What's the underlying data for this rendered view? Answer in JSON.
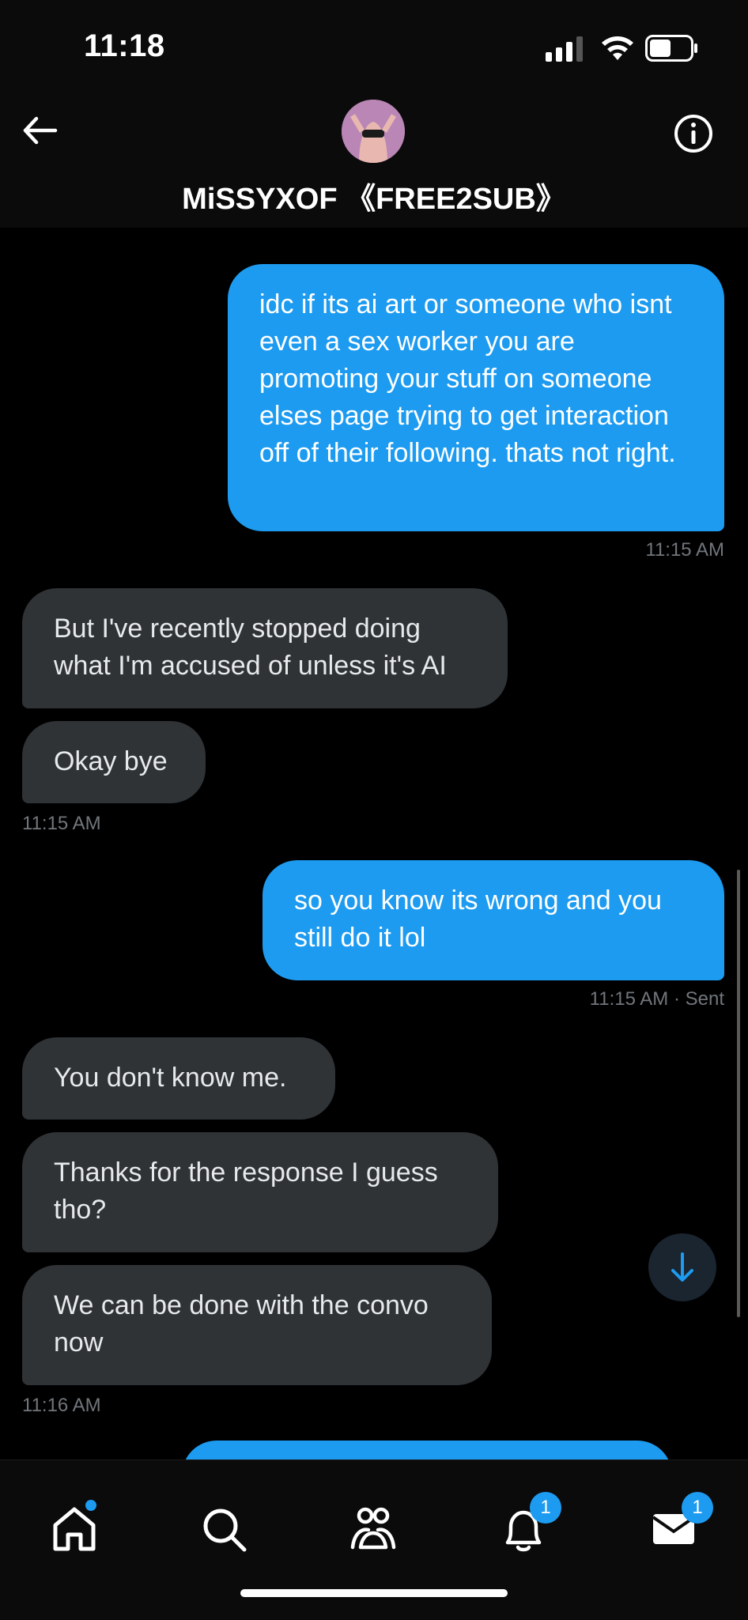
{
  "status_bar": {
    "time": "11:18"
  },
  "header": {
    "contact_name": "MiSSYXOF 《FREE2SUB》"
  },
  "messages": [
    {
      "text": "idc if its ai art or someone who isnt even a sex worker you are promoting your stuff on someone elses page trying to get interaction off of their following. thats not right.",
      "direction": "outgoing",
      "timestamp": "11:15 AM"
    },
    {
      "text": "But I've recently stopped doing what I'm accused of unless it's AI",
      "direction": "incoming"
    },
    {
      "text": "Okay bye",
      "direction": "incoming",
      "timestamp": "11:15 AM"
    },
    {
      "text": "so you know its wrong and you still do it lol",
      "direction": "outgoing",
      "timestamp": "11:15 AM · Sent"
    },
    {
      "text": "You don't know me.",
      "direction": "incoming"
    },
    {
      "text": "Thanks for the response I guess tho?",
      "direction": "incoming"
    },
    {
      "text": "We can be done with the convo now",
      "direction": "incoming",
      "timestamp": "11:16 AM"
    }
  ],
  "nav": {
    "notifications_badge": "1",
    "messages_badge": "1"
  },
  "colors": {
    "accent": "#1d9bf0",
    "incoming_bubble": "#2f3336",
    "background": "#000000"
  }
}
